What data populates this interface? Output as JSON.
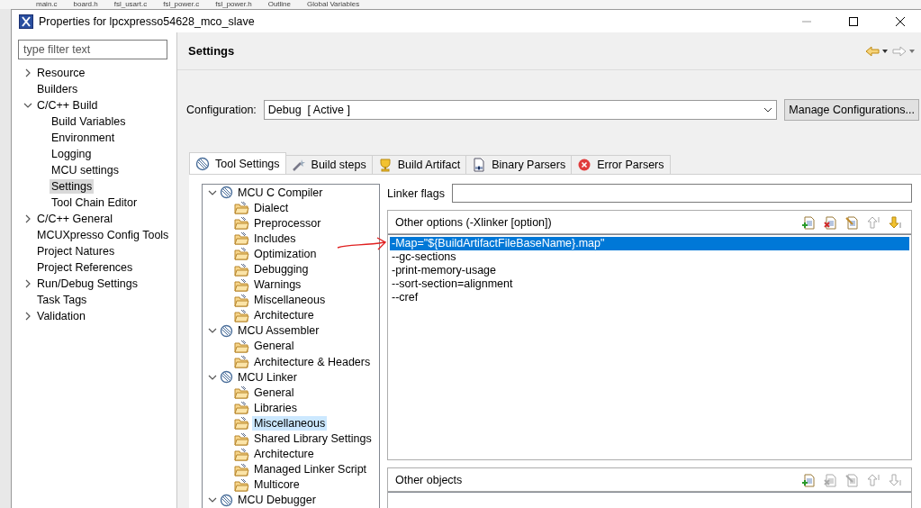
{
  "background_tabs": [
    {
      "label": "main.c"
    },
    {
      "label": "board.h"
    },
    {
      "label": "fsl_usart.c"
    },
    {
      "label": "fsl_power.c"
    },
    {
      "label": "fsl_power.h"
    },
    {
      "label": "Outline"
    },
    {
      "label": "Global Variables"
    }
  ],
  "window": {
    "title": "Properties for lpcxpresso54628_mco_slave"
  },
  "filter": {
    "placeholder": "type filter text"
  },
  "sidebar": {
    "items": [
      {
        "label": "Resource",
        "expanded": false,
        "selected": false
      },
      {
        "label": "Builders",
        "selected": false
      },
      {
        "label": "C/C++ Build",
        "expanded": true,
        "selected": false,
        "children": [
          {
            "label": "Build Variables",
            "selected": false
          },
          {
            "label": "Environment",
            "selected": false
          },
          {
            "label": "Logging",
            "selected": false
          },
          {
            "label": "MCU settings",
            "selected": false
          },
          {
            "label": "Settings",
            "selected": true
          },
          {
            "label": "Tool Chain Editor",
            "selected": false
          }
        ]
      },
      {
        "label": "C/C++ General",
        "expanded": false,
        "selected": false
      },
      {
        "label": "MCUXpresso Config Tools",
        "selected": false
      },
      {
        "label": "Project Natures",
        "selected": false
      },
      {
        "label": "Project References",
        "selected": false
      },
      {
        "label": "Run/Debug Settings",
        "expanded": false,
        "selected": false
      },
      {
        "label": "Task Tags",
        "selected": false
      },
      {
        "label": "Validation",
        "expanded": false,
        "selected": false
      }
    ]
  },
  "page": {
    "title": "Settings"
  },
  "configuration": {
    "label": "Configuration:",
    "value": "Debug  [ Active ]",
    "button": "Manage Configurations..."
  },
  "tabs": [
    {
      "label": "Tool Settings",
      "kind": "tool",
      "selected": true
    },
    {
      "label": "Build steps",
      "kind": "steps",
      "selected": false
    },
    {
      "label": "Build Artifact",
      "kind": "artifact",
      "selected": false
    },
    {
      "label": "Binary Parsers",
      "kind": "binary",
      "selected": false
    },
    {
      "label": "Error Parsers",
      "kind": "error",
      "selected": false
    }
  ],
  "tool_tree": [
    {
      "label": "MCU C Compiler",
      "expanded": true,
      "selected": false,
      "children": [
        {
          "label": "Dialect",
          "selected": false
        },
        {
          "label": "Preprocessor",
          "selected": false
        },
        {
          "label": "Includes",
          "selected": false
        },
        {
          "label": "Optimization",
          "selected": false
        },
        {
          "label": "Debugging",
          "selected": false
        },
        {
          "label": "Warnings",
          "selected": false
        },
        {
          "label": "Miscellaneous",
          "selected": false
        },
        {
          "label": "Architecture",
          "selected": false
        }
      ]
    },
    {
      "label": "MCU Assembler",
      "expanded": true,
      "selected": false,
      "children": [
        {
          "label": "General",
          "selected": false
        },
        {
          "label": "Architecture & Headers",
          "selected": false
        }
      ]
    },
    {
      "label": "MCU Linker",
      "expanded": true,
      "selected": false,
      "children": [
        {
          "label": "General",
          "selected": false
        },
        {
          "label": "Libraries",
          "selected": false
        },
        {
          "label": "Miscellaneous",
          "selected": true
        },
        {
          "label": "Shared Library Settings",
          "selected": false
        },
        {
          "label": "Architecture",
          "selected": false
        },
        {
          "label": "Managed Linker Script",
          "selected": false
        },
        {
          "label": "Multicore",
          "selected": false
        }
      ]
    },
    {
      "label": "MCU Debugger",
      "expanded": true,
      "selected": false
    }
  ],
  "linker_flags": {
    "label": "Linker flags"
  },
  "other_options": {
    "title": "Other options (-Xlinker [option])",
    "toolbar": [
      {
        "kind": "add",
        "disabled": false
      },
      {
        "kind": "delete",
        "disabled": false
      },
      {
        "kind": "edit",
        "disabled": false
      },
      {
        "kind": "up",
        "disabled": true
      },
      {
        "kind": "down",
        "disabled": false
      }
    ],
    "items": [
      {
        "text": "-Map=\"${BuildArtifactFileBaseName}.map\"",
        "selected": true
      },
      {
        "text": "--gc-sections",
        "selected": false
      },
      {
        "text": "-print-memory-usage",
        "selected": false
      },
      {
        "text": "--sort-section=alignment",
        "selected": false
      },
      {
        "text": "--cref",
        "selected": false
      }
    ]
  },
  "other_objects": {
    "title": "Other objects",
    "toolbar": [
      {
        "kind": "add",
        "disabled": false
      },
      {
        "kind": "delete",
        "disabled": true
      },
      {
        "kind": "edit",
        "disabled": true
      },
      {
        "kind": "up",
        "disabled": true
      },
      {
        "kind": "down",
        "disabled": true
      }
    ]
  }
}
